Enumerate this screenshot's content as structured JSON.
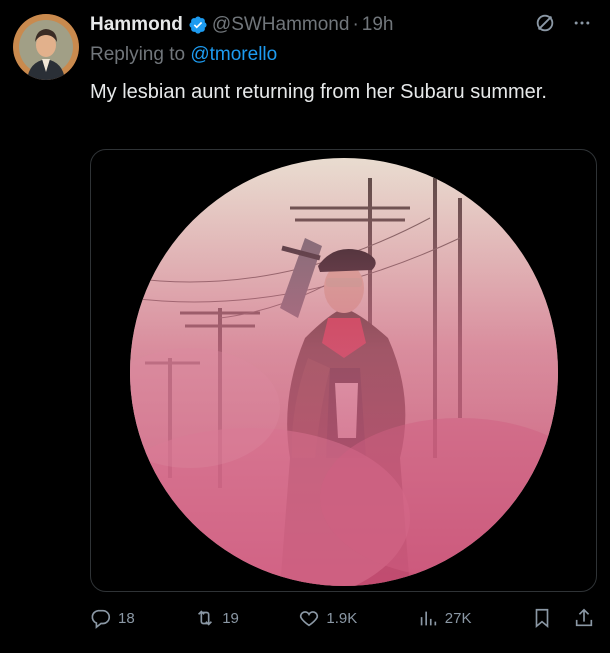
{
  "tweet": {
    "author_name": "Hammond",
    "author_handle": "@SWHammond",
    "separator": "·",
    "timestamp": "19h",
    "reply_prefix": "Replying to",
    "reply_to": "@tmorello",
    "text": "My lesbian aunt returning from her Subaru summer."
  },
  "actions": {
    "replies": "18",
    "retweets": "19",
    "likes": "1.9K",
    "views": "27K"
  },
  "icons": {
    "verified": "verified-badge-icon",
    "grok": "grok-icon",
    "more": "more-icon",
    "reply": "reply-icon",
    "retweet": "retweet-icon",
    "like": "heart-icon",
    "views": "views-icon",
    "bookmark": "bookmark-icon",
    "share": "share-icon"
  },
  "colors": {
    "background": "#000000",
    "primary_text": "#e7e9ea",
    "secondary_text": "#71767b",
    "link": "#1d9bf0",
    "verified": "#1d9bf0"
  }
}
